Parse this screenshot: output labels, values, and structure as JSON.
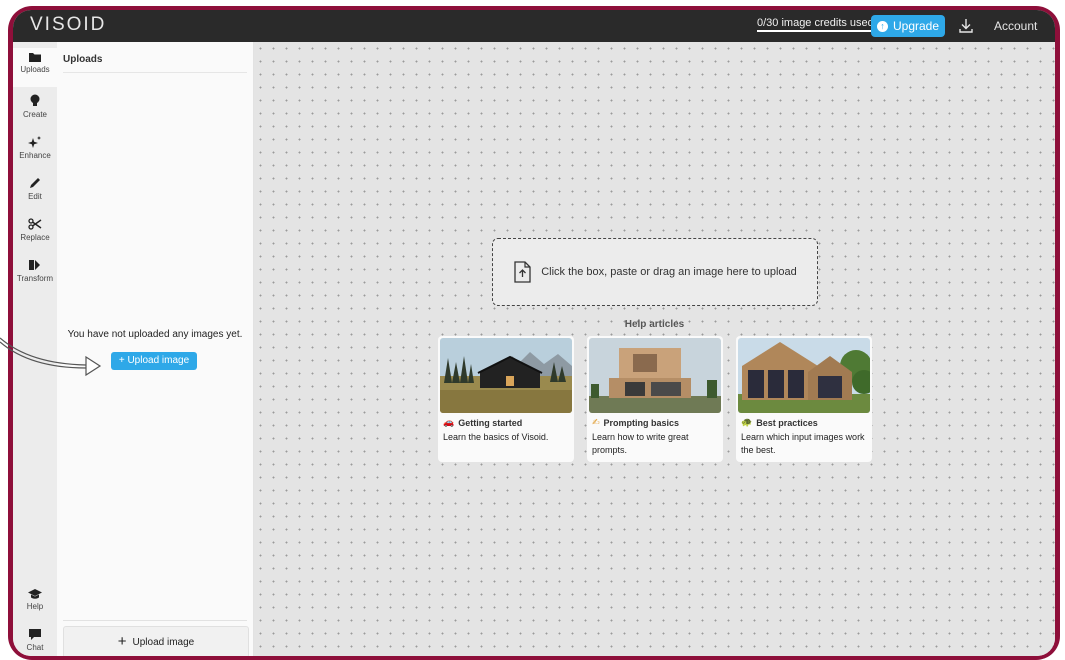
{
  "app": {
    "logo": "VISOID"
  },
  "topbar": {
    "credits": "0/30 image credits used",
    "upgrade_label": "Upgrade",
    "account_label": "Account"
  },
  "rail": {
    "items": [
      {
        "label": "Uploads"
      },
      {
        "label": "Create"
      },
      {
        "label": "Enhance"
      },
      {
        "label": "Edit"
      },
      {
        "label": "Replace"
      },
      {
        "label": "Transform"
      },
      {
        "label": "Help"
      },
      {
        "label": "Chat"
      }
    ]
  },
  "panel": {
    "title": "Uploads",
    "empty_text": "You have not uploaded any images yet.",
    "upload_button_small": "+ Upload image",
    "upload_button_bottom": "Upload image"
  },
  "canvas": {
    "dropzone_text": "Click the box, paste or drag an image here to upload",
    "help_title": "Help articles",
    "articles": [
      {
        "title": "Getting started",
        "desc": "Learn the basics of Visoid."
      },
      {
        "title": "Prompting basics",
        "desc": "Learn how to write great prompts."
      },
      {
        "title": "Best practices",
        "desc": "Learn which input images work the best."
      }
    ]
  },
  "colors": {
    "frame": "#8e0f3a",
    "accent": "#2ea8e8",
    "topbar": "#2a2a2a"
  }
}
